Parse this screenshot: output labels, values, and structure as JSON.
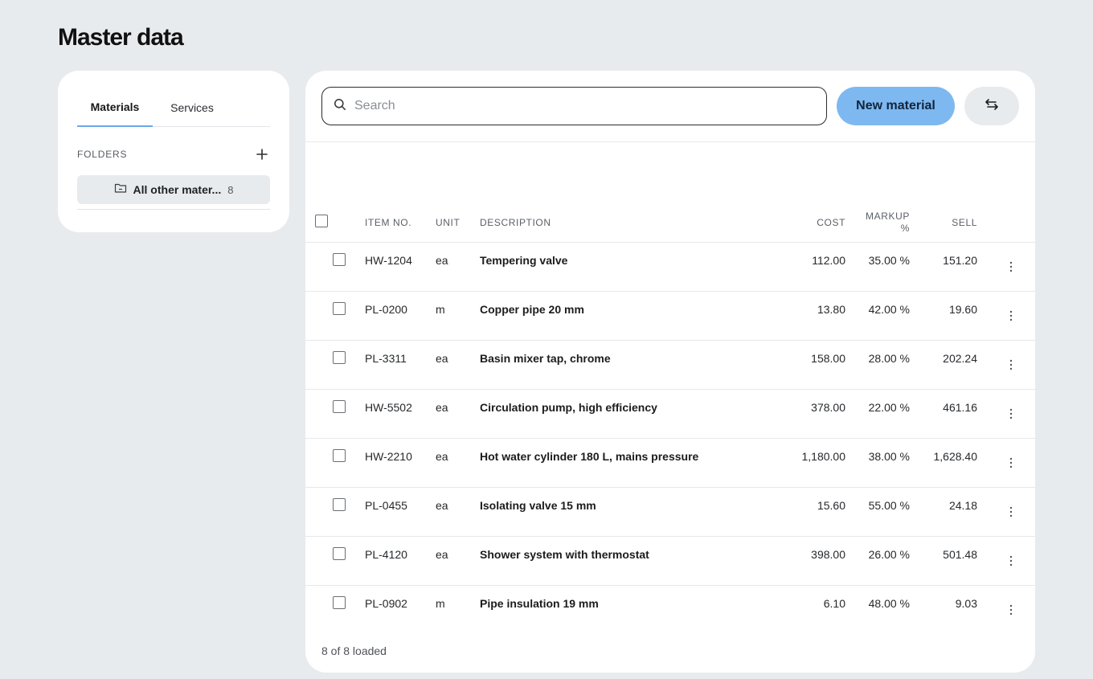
{
  "page": {
    "title": "Master data"
  },
  "sidebar": {
    "tabs": [
      {
        "label": "Materials",
        "active": true
      },
      {
        "label": "Services",
        "active": false
      }
    ],
    "folders_label": "FOLDERS",
    "add_icon": "plus-icon",
    "folder": {
      "icon": "folder-icon",
      "name": "All other mater...",
      "count": "8"
    }
  },
  "toolbar": {
    "search_placeholder": "Search",
    "search_value": "",
    "new_button": "New material",
    "swap_icon": "swap-arrows-icon",
    "accent": "#7eb8f0"
  },
  "table": {
    "headers": {
      "item_no": "ITEM NO.",
      "unit": "UNIT",
      "description": "DESCRIPTION",
      "cost": "COST",
      "markup_line1": "MARKUP",
      "markup_line2": "%",
      "sell": "SELL"
    },
    "rows": [
      {
        "item_no": "HW-1204",
        "unit": "ea",
        "description": "Tempering valve",
        "cost": "112.00",
        "markup": "35.00 %",
        "sell": "151.20"
      },
      {
        "item_no": "PL-0200",
        "unit": "m",
        "description": "Copper pipe 20 mm",
        "cost": "13.80",
        "markup": "42.00 %",
        "sell": "19.60"
      },
      {
        "item_no": "PL-3311",
        "unit": "ea",
        "description": "Basin mixer tap, chrome",
        "cost": "158.00",
        "markup": "28.00 %",
        "sell": "202.24"
      },
      {
        "item_no": "HW-5502",
        "unit": "ea",
        "description": "Circulation pump, high efficiency",
        "cost": "378.00",
        "markup": "22.00 %",
        "sell": "461.16"
      },
      {
        "item_no": "HW-2210",
        "unit": "ea",
        "description": "Hot water cylinder 180 L, mains pressure",
        "cost": "1,180.00",
        "markup": "38.00 %",
        "sell": "1,628.40"
      },
      {
        "item_no": "PL-0455",
        "unit": "ea",
        "description": "Isolating valve 15 mm",
        "cost": "15.60",
        "markup": "55.00 %",
        "sell": "24.18"
      },
      {
        "item_no": "PL-4120",
        "unit": "ea",
        "description": "Shower system with thermostat",
        "cost": "398.00",
        "markup": "26.00 %",
        "sell": "501.48"
      },
      {
        "item_no": "PL-0902",
        "unit": "m",
        "description": "Pipe insulation 19 mm",
        "cost": "6.10",
        "markup": "48.00 %",
        "sell": "9.03"
      }
    ],
    "footer": "8 of 8 loaded"
  }
}
